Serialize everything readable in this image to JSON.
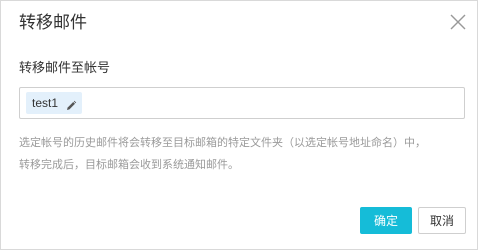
{
  "dialog": {
    "title": "转移邮件",
    "close_icon": "close-icon"
  },
  "form": {
    "field_label": "转移邮件至帐号",
    "selected_account": "test1",
    "edit_icon": "pencil-icon"
  },
  "help": {
    "line1": "选定帐号的历史邮件将会转移至目标邮箱的特定文件夹（以选定帐号地址命名）中，",
    "line2": "转移完成后，目标邮箱会收到系统通知邮件。"
  },
  "buttons": {
    "confirm_label": "确定",
    "cancel_label": "取消"
  },
  "colors": {
    "accent": "#15bcd8",
    "tag_bg": "#e3f0fb"
  }
}
